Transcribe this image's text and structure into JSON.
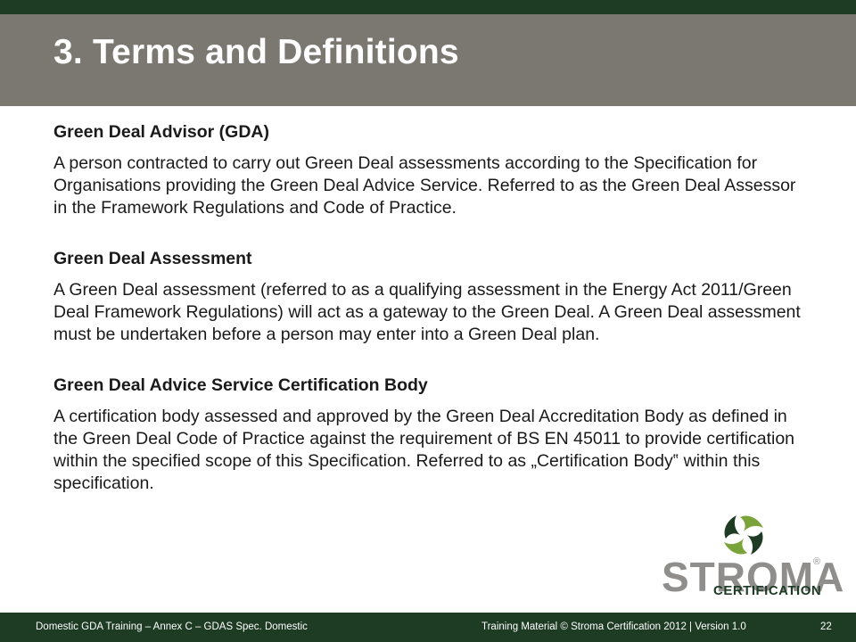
{
  "header": {
    "title": "3. Terms and Definitions"
  },
  "terms": [
    {
      "term": "Green Deal Advisor (GDA)",
      "definition": "A person contracted to carry out Green Deal assessments according to the Specification for Organisations providing the Green Deal Advice Service. Referred to as the Green Deal Assessor in the Framework Regulations and Code of Practice."
    },
    {
      "term": "Green Deal Assessment",
      "definition": "A Green Deal assessment (referred to as a qualifying assessment in the Energy Act 2011/Green Deal Framework Regulations) will act as a gateway to the Green Deal. A Green Deal assessment must be undertaken before a person may enter into a Green Deal plan."
    },
    {
      "term": "Green Deal Advice Service Certification Body",
      "definition": "A certification body assessed and approved by the Green Deal Accreditation Body as defined in the Green Deal Code of Practice against the requirement of BS EN 45011 to provide certification within the specified scope of this Specification. Referred to as „Certification Body‟ within this specification."
    }
  ],
  "logo": {
    "wordmark": "STROMA",
    "registered": "®",
    "subtitle": "CERTIFICATION",
    "icon": "stroma-swirl-icon"
  },
  "footer": {
    "left": "Domestic GDA Training – Annex C – GDAS Spec. Domestic",
    "right": "Training Material © Stroma Certification 2012  |  Version 1.0",
    "page_number": "22"
  },
  "colors": {
    "dark_green": "#1e3b24",
    "title_band_grey": "#7b7872",
    "logo_grey": "#8f8e8c",
    "logo_green": "#7aa33a"
  }
}
